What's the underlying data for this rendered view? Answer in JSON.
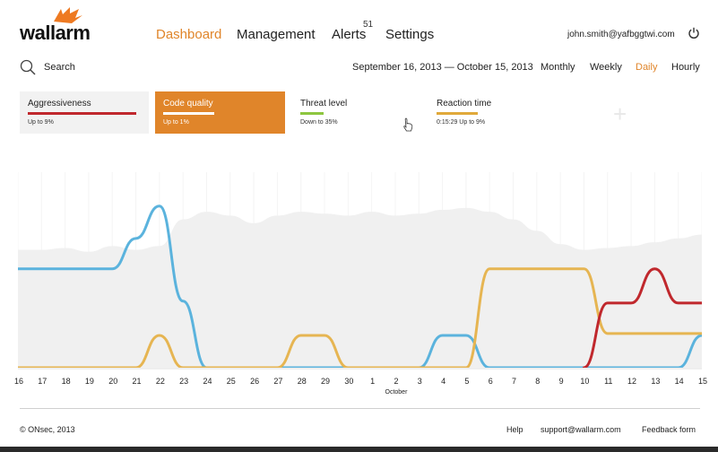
{
  "header": {
    "logo_text": "wallarm",
    "nav": [
      {
        "label": "Dashboard",
        "active": true
      },
      {
        "label": "Management",
        "active": false
      },
      {
        "label": "Alerts",
        "active": false
      },
      {
        "label": "Settings",
        "active": false
      }
    ],
    "alerts_count": "51",
    "user_email": "john.smith@yafbggtwi.com",
    "power_icon": "power-icon"
  },
  "toolbar": {
    "search_label": "Search",
    "date_range": "September 16, 2013 — October 15, 2013",
    "periods": [
      {
        "label": "Monthly",
        "active": false
      },
      {
        "label": "Weekly",
        "active": false
      },
      {
        "label": "Daily",
        "active": true
      },
      {
        "label": "Hourly",
        "active": false
      }
    ]
  },
  "cards": [
    {
      "title": "Aggressiveness",
      "sub": "Up to 9%",
      "color": "#c0282d",
      "selected": false
    },
    {
      "title": "Code quality",
      "sub": "Up to 1%",
      "color": "#ffffff",
      "selected": true
    },
    {
      "title": "Threat level",
      "sub": "Down to 35%",
      "color": "#8dc63f",
      "selected": false
    },
    {
      "title": "Reaction time",
      "sub": "0:15:29   Up to 9%",
      "color": "#e0a93a",
      "selected": false
    }
  ],
  "colors": {
    "accent": "#e0852a",
    "blue": "#5bb3dd",
    "red": "#c0282d",
    "yellow": "#e6b552",
    "background_area": "#f3f3f3"
  },
  "chart_data": {
    "type": "line",
    "x": [
      "16",
      "17",
      "18",
      "19",
      "20",
      "21",
      "22",
      "23",
      "24",
      "25",
      "26",
      "27",
      "28",
      "29",
      "30",
      "1",
      "2",
      "3",
      "4",
      "5",
      "6",
      "7",
      "8",
      "9",
      "10",
      "11",
      "12",
      "13",
      "14",
      "15"
    ],
    "month_labels": [
      {
        "index": 16,
        "label": "October"
      }
    ],
    "ylim": [
      0,
      100
    ],
    "grid": true,
    "series": [
      {
        "color": "#f0f0f0",
        "type": "area",
        "values": [
          62,
          62,
          63,
          61,
          64,
          62,
          64,
          78,
          82,
          80,
          76,
          80,
          82,
          81,
          80,
          82,
          80,
          81,
          83,
          84,
          82,
          78,
          72,
          65,
          62,
          63,
          64,
          66,
          68,
          70
        ]
      },
      {
        "color": "#5bb3dd",
        "values": [
          52,
          52,
          52,
          52,
          52,
          68,
          85,
          35,
          0,
          0,
          0,
          0,
          0,
          0,
          0,
          0,
          0,
          0,
          17,
          17,
          0,
          0,
          0,
          0,
          0,
          0,
          0,
          0,
          0,
          17
        ]
      },
      {
        "color": "#e6b552",
        "values": [
          0,
          0,
          0,
          0,
          0,
          0,
          17,
          0,
          0,
          0,
          0,
          0,
          17,
          17,
          0,
          0,
          0,
          0,
          0,
          0,
          52,
          52,
          52,
          52,
          52,
          18,
          18,
          18,
          18,
          18
        ]
      },
      {
        "color": "#c0282d",
        "values": [
          null,
          null,
          null,
          null,
          null,
          null,
          null,
          null,
          null,
          null,
          null,
          null,
          null,
          null,
          null,
          null,
          null,
          null,
          null,
          null,
          null,
          null,
          null,
          null,
          0,
          34,
          34,
          52,
          34,
          34
        ]
      }
    ]
  },
  "footer": {
    "copyright": "© ONsec, 2013",
    "help": "Help",
    "support": "support@wallarm.com",
    "feedback": "Feedback form"
  }
}
